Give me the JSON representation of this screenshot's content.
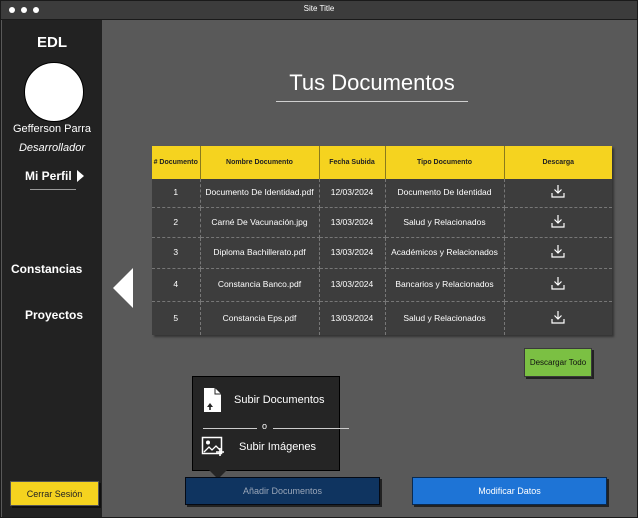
{
  "window": {
    "title": "Site Title"
  },
  "sidebar": {
    "brand": "EDL",
    "user_name": "Gefferson Parra",
    "user_role": "Desarrollador",
    "profile_label": "Mi Perfil",
    "nav": [
      {
        "label": "Constancias"
      },
      {
        "label": "Proyectos"
      }
    ],
    "logout_label": "Cerrar Sesión"
  },
  "main": {
    "heading": "Tus Documentos",
    "table": {
      "headers": [
        "# Documento",
        "Nombre Documento",
        "Fecha Subida",
        "Tipo Documento",
        "Descarga"
      ],
      "rows": [
        {
          "num": "1",
          "name": "Documento De Identidad.pdf",
          "date": "12/03/2024",
          "type": "Documento De Identidad",
          "icon": "download-icon"
        },
        {
          "num": "2",
          "name": "Carné De Vacunación.jpg",
          "date": "13/03/2024",
          "type": "Salud y Relacionados",
          "icon": "download-icon"
        },
        {
          "num": "3",
          "name": "Diploma Bachillerato.pdf",
          "date": "13/03/2024",
          "type": "Académicos y Relacionados",
          "icon": "download-icon"
        },
        {
          "num": "4",
          "name": "Constancia Banco.pdf",
          "date": "13/03/2024",
          "type": "Bancarios y Relacionados",
          "icon": "download-icon"
        },
        {
          "num": "5",
          "name": "Constancia Eps.pdf",
          "date": "13/03/2024",
          "type": "Salud y Relacionados",
          "icon": "download-icon"
        }
      ]
    },
    "download_all_label": "Descargar Todo",
    "popup": {
      "upload_docs_label": "Subir Documentos",
      "or_label": "o",
      "upload_images_label": "Subir Imágenes"
    },
    "add_docs_label": "Añadir Documentos",
    "modify_data_label": "Modificar Datos"
  },
  "colors": {
    "accent_yellow": "#f5d31f",
    "download_all_green": "#7bc043",
    "add_button_navy": "#0f3460",
    "modify_button_blue": "#1e74d6"
  }
}
